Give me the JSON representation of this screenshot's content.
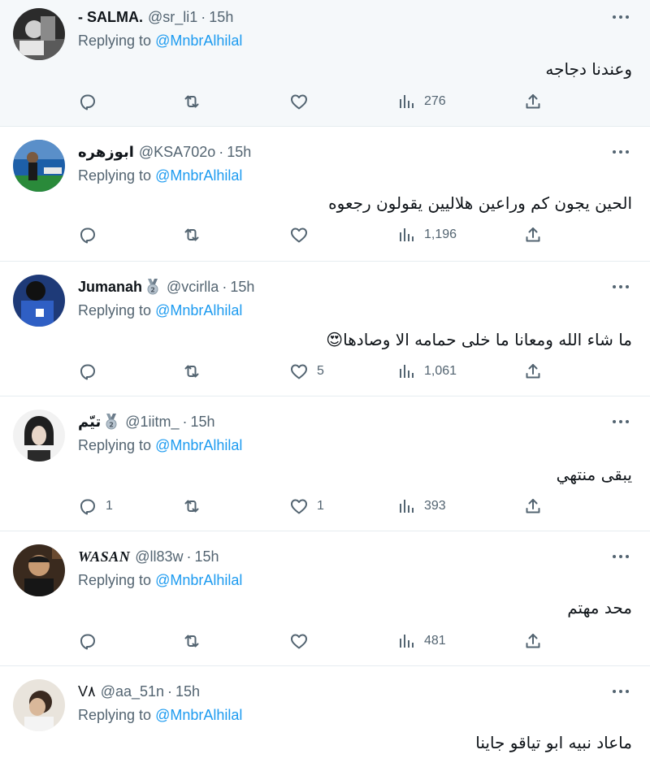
{
  "reply_prefix": "Replying to",
  "reply_target": "@MnbrAlhilal",
  "dot": "·",
  "icons": {
    "reply": "reply-icon",
    "retweet": "retweet-icon",
    "like": "heart-icon",
    "views": "views-icon",
    "share": "share-icon",
    "more": "more-icon"
  },
  "colors": {
    "link": "#1d9bf0",
    "secondary": "#536471",
    "highlight_bg": "#f5f8fa",
    "divider": "#e6ecf0"
  },
  "tweets": [
    {
      "name": "- SALMA.",
      "handle": "@sr_li1",
      "time": "15h",
      "text": "وعندنا دجاجه",
      "replies": "",
      "likes": "",
      "views": "276"
    },
    {
      "name": "ابوزهره",
      "handle": "@KSA702o",
      "time": "15h",
      "text": "الحين يجون كم وراعين هلاليين يقولون رجعوه",
      "replies": "",
      "likes": "",
      "views": "1,196"
    },
    {
      "name": "Jumanah",
      "handle": "@vcirlla",
      "time": "15h",
      "text": "ما شاء الله ومعانا ما خلى حمامه الا وصادها😍",
      "replies": "",
      "likes": "5",
      "views": "1,061"
    },
    {
      "name": "تيّم",
      "handle": "@1iitm_",
      "time": "15h",
      "text": "يبقى منتهي",
      "replies": "1",
      "likes": "1",
      "views": "393"
    },
    {
      "name": "WASAN",
      "handle": "@ll83w",
      "time": "15h",
      "text": "محد مهتم",
      "replies": "",
      "likes": "",
      "views": "481"
    },
    {
      "name": "V۸",
      "handle": "@aa_51n",
      "time": "15h",
      "text": "ماعاد نبيه ابو تياقو جاينا",
      "replies": "",
      "likes": "",
      "views": ""
    }
  ]
}
